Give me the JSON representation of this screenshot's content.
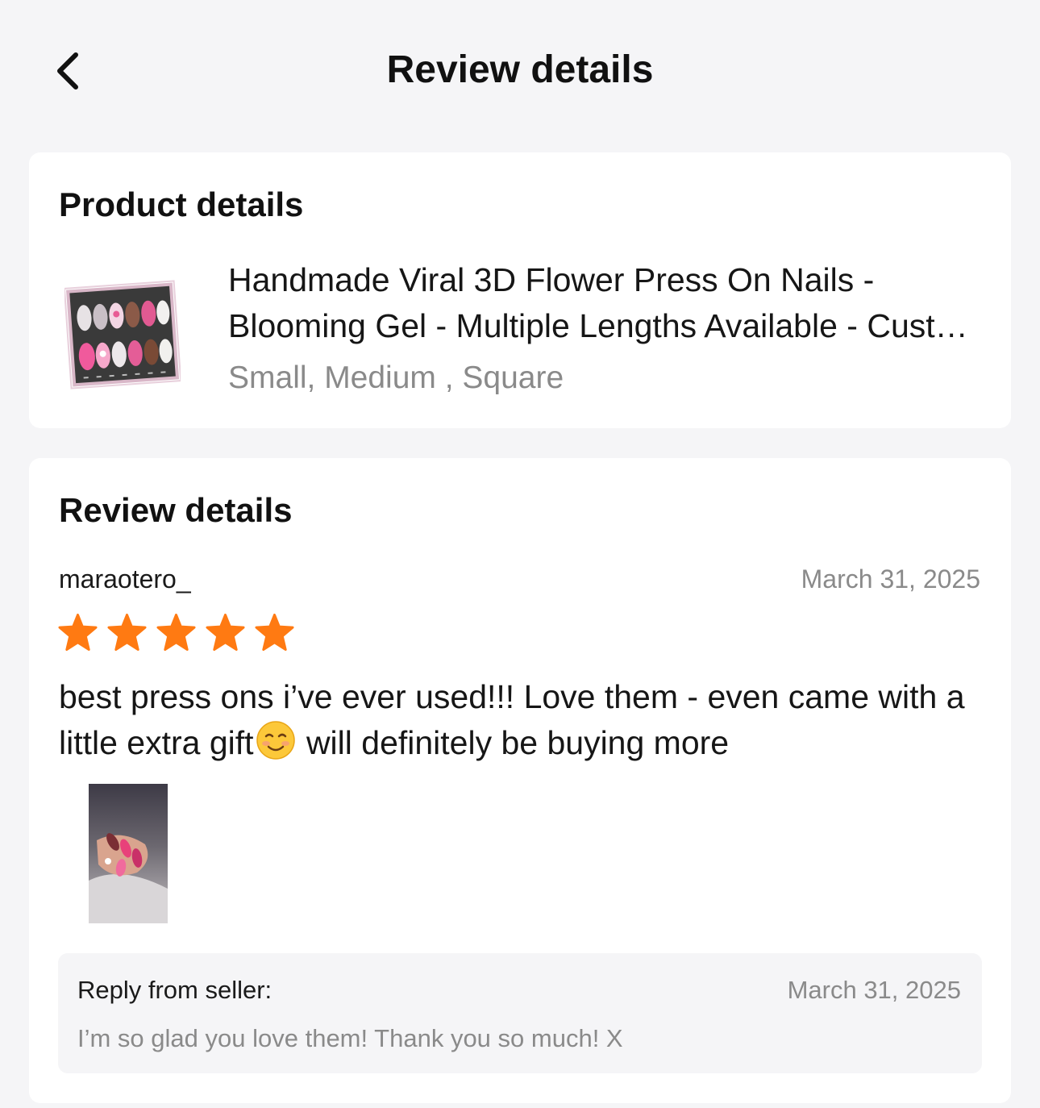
{
  "header": {
    "title": "Review details",
    "back_icon": "chevron-left-icon"
  },
  "product_card": {
    "heading": "Product details",
    "product_title": "Handmade Viral 3D Flower Press On Nails - Blooming Gel - Multiple Lengths Available - Custom Sizes",
    "variant": "Small, Medium , Square",
    "thumbnail_label": "Nail Art"
  },
  "review_card": {
    "heading": "Review details",
    "reviewer": "maraotero_",
    "date": "March 31, 2025",
    "rating": 5,
    "rating_max": 5,
    "star_color": "#ff7a12",
    "text_before_emoji": "best press ons i’ve ever used!!! Love them - even came with a little extra gift",
    "emoji_icon": "smiling-face-icon",
    "text_after_emoji": " will definitely be buying more",
    "reply": {
      "label": "Reply from seller:",
      "date": "March 31, 2025",
      "text": "I’m so glad you love them! Thank you so much! X"
    }
  }
}
